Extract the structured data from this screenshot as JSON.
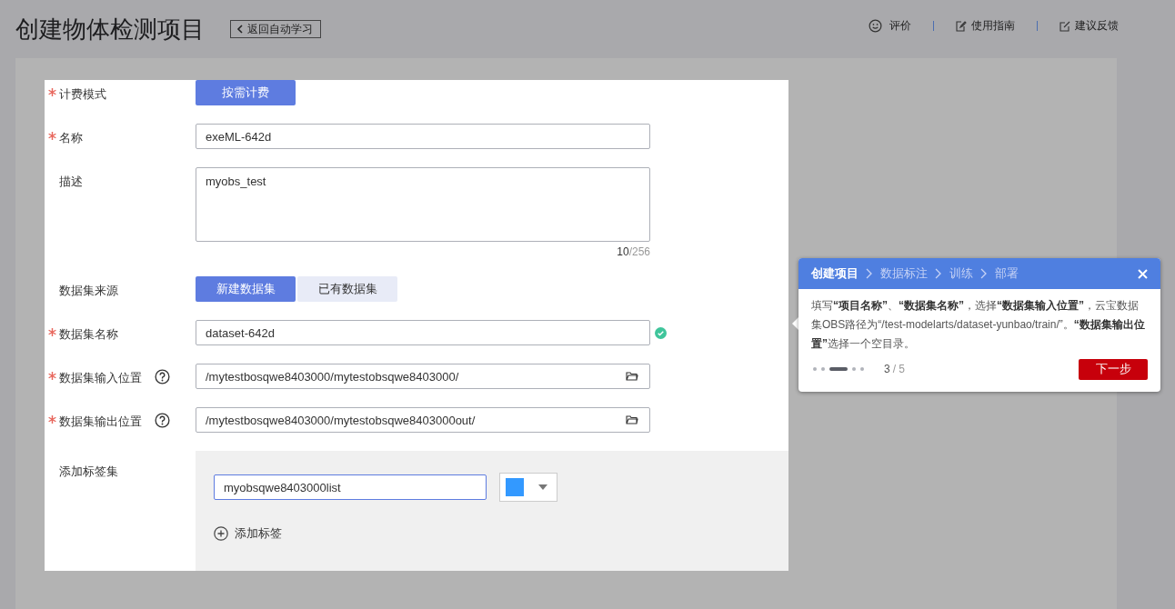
{
  "page_title": "创建物体检测项目",
  "back_link": {
    "label": "返回自动学习"
  },
  "header_links": [
    {
      "kind": "rate",
      "label": "评价"
    },
    {
      "kind": "guide",
      "label": "使用指南"
    },
    {
      "kind": "feedback",
      "label": "建议反馈"
    }
  ],
  "form": {
    "fields": [
      {
        "kind": "buttons",
        "label": "计费模式",
        "required": true,
        "options": [
          {
            "label": "按需计费",
            "selected": true
          }
        ]
      },
      {
        "kind": "text",
        "label": "名称",
        "required": true,
        "value": "exeML-642d"
      },
      {
        "kind": "textarea",
        "label": "描述",
        "required": false,
        "value": "myobs_test",
        "count": "**10**/256"
      },
      {
        "kind": "buttons",
        "label": "数据集来源",
        "required": false,
        "options": [
          {
            "label": "新建数据集",
            "selected": true
          },
          {
            "label": "已有数据集",
            "selected": false
          }
        ]
      },
      {
        "kind": "text",
        "label": "数据集名称",
        "required": true,
        "value": "dataset-642d",
        "valid": true
      },
      {
        "kind": "path",
        "label": "数据集输入位置",
        "required": true,
        "help": true,
        "value": "/mytestbosqwe8403000/mytestobsqwe8403000/"
      },
      {
        "kind": "path",
        "label": "数据集输出位置",
        "required": true,
        "help": true,
        "value": "/mytestbosqwe8403000/mytestobsqwe8403000out/"
      },
      {
        "kind": "labels",
        "label": "添加标签集",
        "required": false,
        "labels": [
          {
            "value": "myobsqwe8403000list",
            "color": "#3399ff"
          }
        ],
        "add_label": "添加标签"
      }
    ]
  },
  "guide": {
    "steps": [
      {
        "label": "创建项目",
        "selected": true
      },
      {
        "label": "数据标注",
        "selected": false
      },
      {
        "label": "训练",
        "selected": false
      },
      {
        "label": "部署",
        "selected": false
      }
    ],
    "text": "填写**“项目名称”**、**“数据集名称”**，选择**“数据集输入位置”**，云宝数据集OBS路径为“/test-modelarts/dataset-yunbao/train/”。**“数据集输出位置”**选择一个空目录。",
    "dots": [
      {
        "selected": false
      },
      {
        "selected": false
      },
      {
        "selected": true
      },
      {
        "selected": false
      },
      {
        "selected": false
      }
    ],
    "page_current": "3",
    "page_total": "/ 5",
    "next_button": "下一步"
  }
}
